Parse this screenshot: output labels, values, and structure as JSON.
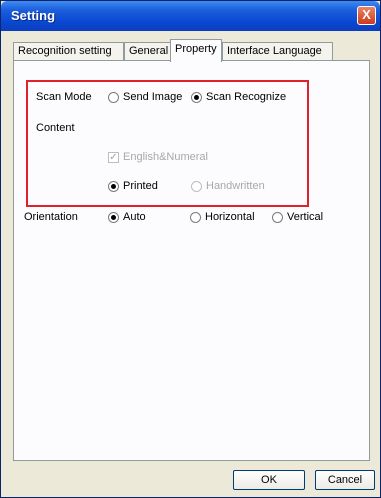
{
  "window": {
    "title": "Setting",
    "close_glyph": "X"
  },
  "tabs": [
    {
      "label": "Recognition setting",
      "active": false
    },
    {
      "label": "General",
      "active": false
    },
    {
      "label": "Property",
      "active": true
    },
    {
      "label": "Interface Language",
      "active": false
    }
  ],
  "scan_mode": {
    "label": "Scan Mode",
    "options": [
      {
        "label": "Send Image",
        "selected": false
      },
      {
        "label": "Scan  Recognize",
        "selected": true
      }
    ]
  },
  "content": {
    "label": "Content",
    "checkbox": {
      "label": "English&Numeral",
      "checked": true,
      "enabled": false
    },
    "options": [
      {
        "label": "Printed",
        "selected": true,
        "enabled": true
      },
      {
        "label": "Handwritten",
        "selected": false,
        "enabled": false
      }
    ]
  },
  "orientation": {
    "label": "Orientation",
    "options": [
      {
        "label": "Auto",
        "selected": true
      },
      {
        "label": "Horizontal",
        "selected": false
      },
      {
        "label": "Vertical",
        "selected": false
      }
    ]
  },
  "buttons": {
    "ok": "OK",
    "cancel": "Cancel"
  },
  "colors": {
    "highlight": "#e0202c",
    "titlebar": "#0a48d2"
  }
}
